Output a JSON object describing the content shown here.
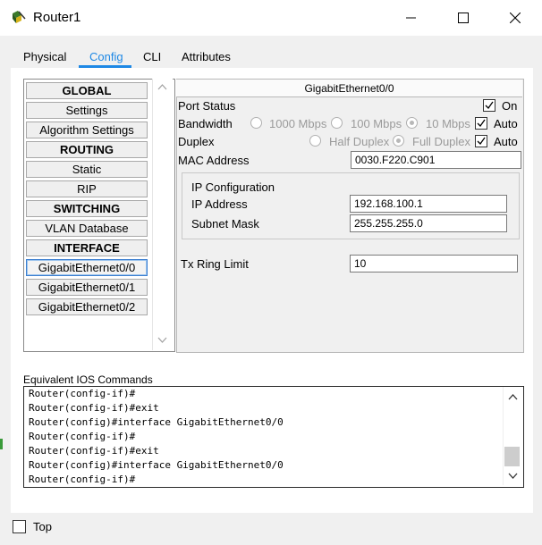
{
  "window": {
    "title": "Router1"
  },
  "tabs": [
    {
      "label": "Physical"
    },
    {
      "label": "Config",
      "active": true
    },
    {
      "label": "CLI"
    },
    {
      "label": "Attributes"
    }
  ],
  "nav": {
    "items": [
      {
        "label": "GLOBAL",
        "kind": "header"
      },
      {
        "label": "Settings"
      },
      {
        "label": "Algorithm Settings"
      },
      {
        "label": "ROUTING",
        "kind": "header"
      },
      {
        "label": "Static"
      },
      {
        "label": "RIP"
      },
      {
        "label": "SWITCHING",
        "kind": "header"
      },
      {
        "label": "VLAN Database"
      },
      {
        "label": "INTERFACE",
        "kind": "header"
      },
      {
        "label": "GigabitEthernet0/0",
        "selected": true
      },
      {
        "label": "GigabitEthernet0/1"
      },
      {
        "label": "GigabitEthernet0/2"
      }
    ]
  },
  "config": {
    "title": "GigabitEthernet0/0",
    "port_status": {
      "label": "Port Status",
      "on_label": "On",
      "on_checked": true
    },
    "bandwidth": {
      "label": "Bandwidth",
      "options": [
        "1000 Mbps",
        "100 Mbps",
        "10 Mbps"
      ],
      "selected": "10 Mbps",
      "auto_label": "Auto",
      "auto_checked": true
    },
    "duplex": {
      "label": "Duplex",
      "options": [
        "Half Duplex",
        "Full Duplex"
      ],
      "selected": "Full Duplex",
      "auto_label": "Auto",
      "auto_checked": true
    },
    "mac": {
      "label": "MAC Address",
      "value": "0030.F220.C901"
    },
    "ip_config": {
      "title": "IP Configuration",
      "ip_label": "IP Address",
      "ip_value": "192.168.100.1",
      "mask_label": "Subnet Mask",
      "mask_value": "255.255.255.0"
    },
    "tx_ring": {
      "label": "Tx Ring Limit",
      "value": "10"
    }
  },
  "ios": {
    "label": "Equivalent IOS Commands",
    "lines": [
      "Router(config-if)#",
      "Router(config-if)#exit",
      "Router(config)#interface GigabitEthernet0/0",
      "Router(config-if)#",
      "Router(config-if)#exit",
      "Router(config)#interface GigabitEthernet0/0",
      "Router(config-if)#"
    ]
  },
  "bottom": {
    "top_label": "Top",
    "top_checked": false
  },
  "colors": {
    "accent": "#1e88e5",
    "selected_border": "#3c7fd0"
  }
}
